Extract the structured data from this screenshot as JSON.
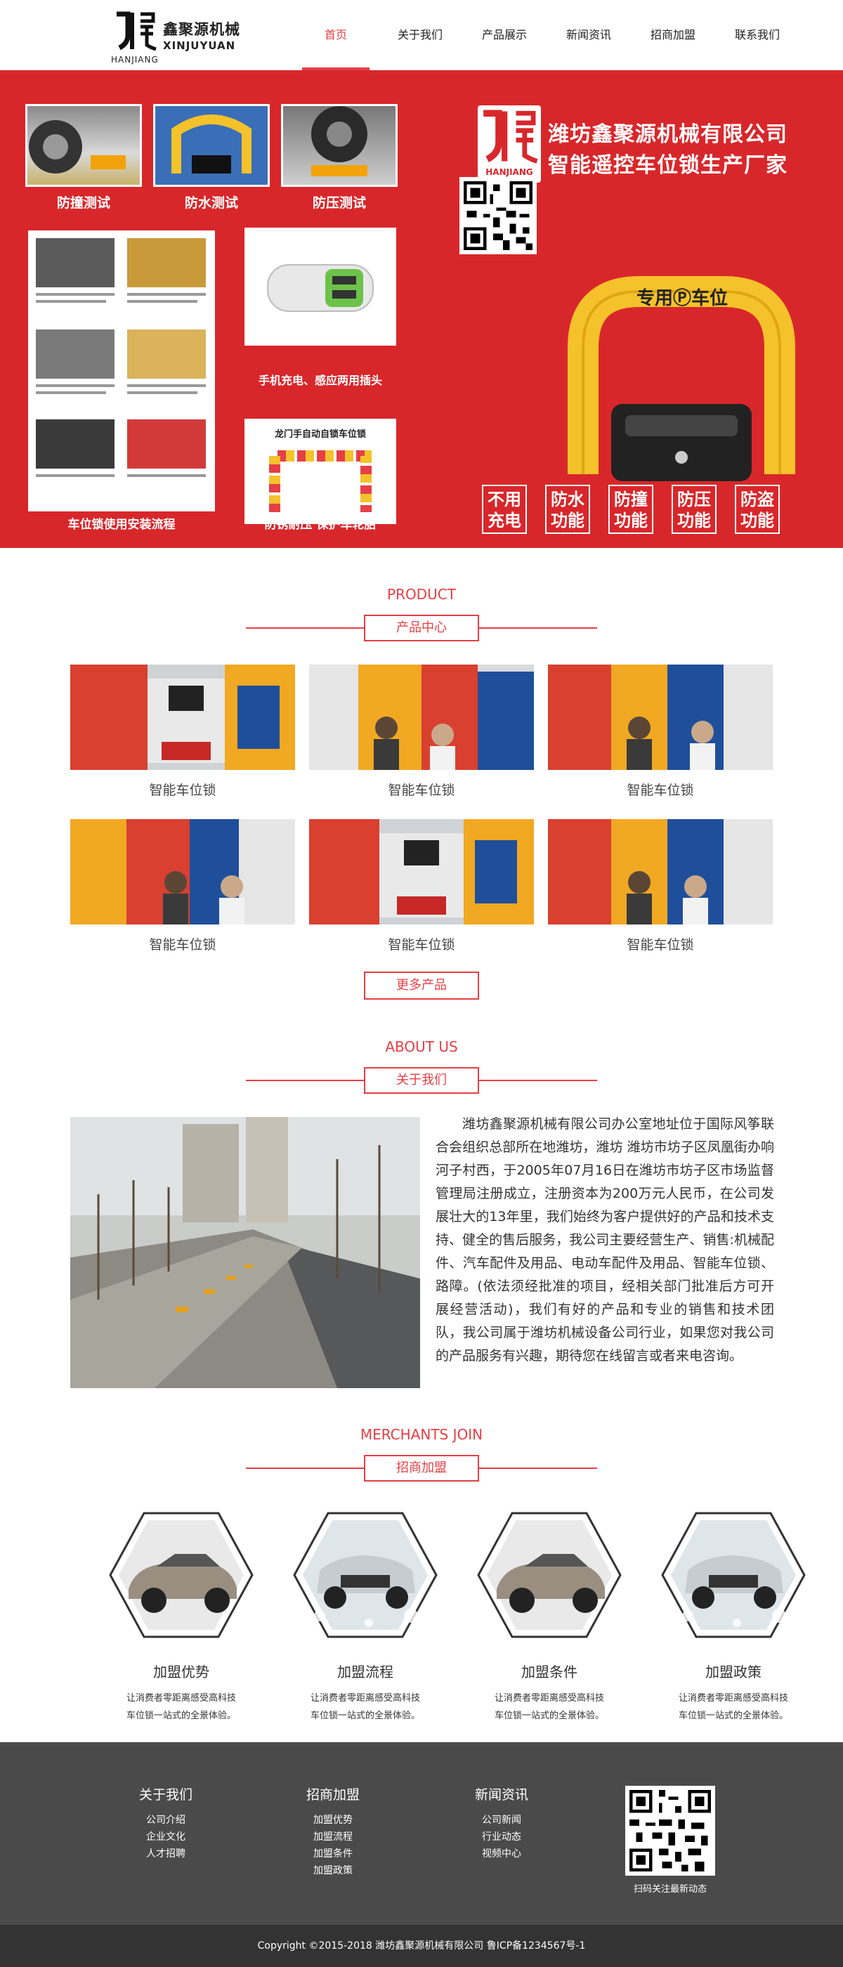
{
  "header": {
    "logo_cn": "鑫聚源机械",
    "logo_en": "XINJUYUAN",
    "logo_pinyin": "HANJIANG",
    "nav": [
      "首页",
      "关于我们",
      "产品展示",
      "新闻资讯",
      "招商加盟",
      "联系我们"
    ]
  },
  "banner": {
    "tests": [
      "防撞测试",
      "防水测试",
      "防压测试"
    ],
    "install_caption": "车位锁使用安装流程",
    "charger_caption": "手机充电、感应两用插头",
    "bar_title": "龙门手自动自锁车位锁",
    "bar_caption": "防锈耐压 保护车轮胎",
    "company": "潍坊鑫聚源机械有限公司",
    "slogan": "智能遥控车位锁生产厂家",
    "brand_pinyin": "HANJIANG",
    "lock_label": "专用Ⓟ车位",
    "features": [
      [
        "不用",
        "充电"
      ],
      [
        "防水",
        "功能"
      ],
      [
        "防撞",
        "功能"
      ],
      [
        "防压",
        "功能"
      ],
      [
        "防盗",
        "功能"
      ]
    ]
  },
  "product": {
    "en": "PRODUCT",
    "cn": "产品中心",
    "items": [
      "智能车位锁",
      "智能车位锁",
      "智能车位锁",
      "智能车位锁",
      "智能车位锁",
      "智能车位锁"
    ],
    "more": "更多产品"
  },
  "about": {
    "en": "ABOUT US",
    "cn": "关于我们",
    "text": "潍坊鑫聚源机械有限公司办公室地址位于国际风筝联合会组织总部所在地潍坊，潍坊 潍坊市坊子区凤凰街办响河子村西，于2005年07月16日在潍坊市坊子区市场监督管理局注册成立，注册资本为200万元人民币，在公司发展壮大的13年里，我们始终为客户提供好的产品和技术支持、健全的售后服务，我公司主要经营生产、销售:机械配件、汽车配件及用品、电动车配件及用品、智能车位锁、路障。(依法须经批准的项目，经相关部门批准后方可开展经营活动)，我们有好的产品和专业的销售和技术团队，我公司属于潍坊机械设备公司行业，如果您对我公司的产品服务有兴趣，期待您在线留言或者来电咨询。"
  },
  "merchants": {
    "en": "MERCHANTS JOIN",
    "cn": "招商加盟",
    "items": [
      {
        "title": "加盟优势",
        "line1": "让消费者零距离感受高科技",
        "line2": "车位锁一站式的全景体验。"
      },
      {
        "title": "加盟流程",
        "line1": "让消费者零距离感受高科技",
        "line2": "车位锁一站式的全景体验。"
      },
      {
        "title": "加盟条件",
        "line1": "让消费者零距离感受高科技",
        "line2": "车位锁一站式的全景体验。"
      },
      {
        "title": "加盟政策",
        "line1": "让消费者零距离感受高科技",
        "line2": "车位锁一站式的全景体验。"
      }
    ]
  },
  "footer": {
    "cols": [
      {
        "title": "关于我们",
        "links": [
          "公司介绍",
          "企业文化",
          "人才招聘"
        ]
      },
      {
        "title": "招商加盟",
        "links": [
          "加盟优势",
          "加盟流程",
          "加盟条件",
          "加盟政策"
        ]
      },
      {
        "title": "新闻资讯",
        "links": [
          "公司新闻",
          "行业动态",
          "视频中心"
        ]
      }
    ],
    "qr_caption": "扫码关注最新动态",
    "copyright": "Copyright ©2015-2018 潍坊鑫聚源机械有限公司 鲁ICP备1234567号-1"
  },
  "colors": {
    "accent": "#e53f45",
    "banner_red": "#d8272b",
    "footer": "#4a4a4a",
    "copyright_bar": "#333333"
  }
}
